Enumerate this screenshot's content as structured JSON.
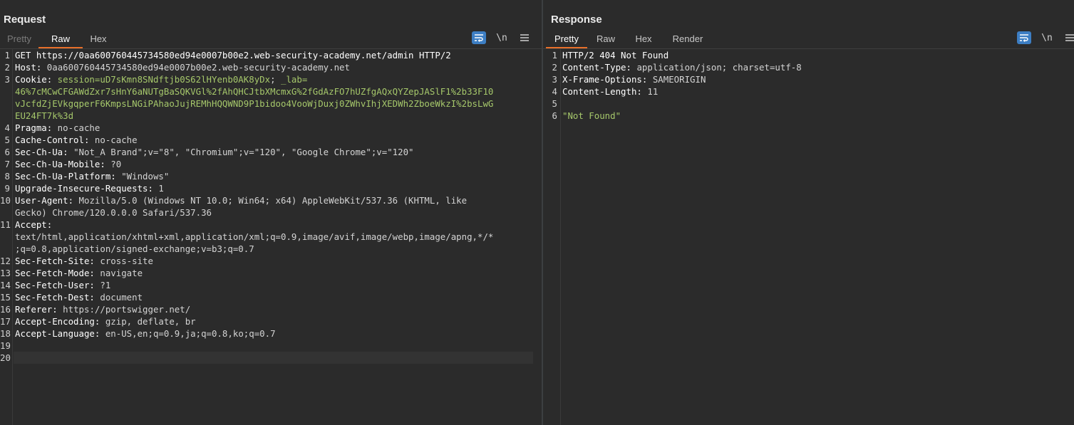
{
  "request": {
    "title": "Request",
    "tabs": [
      {
        "label": "Pretty",
        "state": "disabled"
      },
      {
        "label": "Raw",
        "state": "active"
      },
      {
        "label": "Hex",
        "state": "normal"
      }
    ],
    "toolbar": {
      "newline_label": "\\n"
    },
    "lines": [
      {
        "n": "1",
        "plain": "GET https://0aa600760445734580ed94e0007b00e2.web-security-academy.net/admin HTTP/2"
      },
      {
        "n": "2",
        "name": "Host:",
        "value": " 0aa600760445734580ed94e0007b00e2.web-security-academy.net"
      },
      {
        "n": "3",
        "name": "Cookie:",
        "cookie": " session=uD7sKmn8SNdftjb0S62lHYenb0AK8yDx",
        "value": "; ",
        "cookie2": "_lab="
      },
      {
        "n": "",
        "cookie": "46%7cMCwCFGAWdZxr7sHnY6aNUTgBaSQKVGl%2fAhQHCJtbXMcmxG%2fGdAzFO7hUZfgAQxQYZepJASlF1%2b33F10"
      },
      {
        "n": "",
        "cookie": "vJcfdZjEVkgqperF6KmpsLNGiPAhaoJujREMhHQQWND9P1bidoo4VooWjDuxj0ZWhvIhjXEDWh2ZboeWkzI%2bsLwG"
      },
      {
        "n": "",
        "cookie": "EU24FT7k%3d"
      },
      {
        "n": "4",
        "name": "Pragma:",
        "value": " no-cache"
      },
      {
        "n": "5",
        "name": "Cache-Control:",
        "value": " no-cache"
      },
      {
        "n": "6",
        "name": "Sec-Ch-Ua:",
        "value": " \"Not_A Brand\";v=\"8\", \"Chromium\";v=\"120\", \"Google Chrome\";v=\"120\""
      },
      {
        "n": "7",
        "name": "Sec-Ch-Ua-Mobile:",
        "value": " ?0"
      },
      {
        "n": "8",
        "name": "Sec-Ch-Ua-Platform:",
        "value": " \"Windows\""
      },
      {
        "n": "9",
        "name": "Upgrade-Insecure-Requests:",
        "value": " 1"
      },
      {
        "n": "10",
        "name": "User-Agent:",
        "value": " Mozilla/5.0 (Windows NT 10.0; Win64; x64) AppleWebKit/537.36 (KHTML, like"
      },
      {
        "n": "",
        "value": "Gecko) Chrome/120.0.0.0 Safari/537.36"
      },
      {
        "n": "11",
        "name": "Accept:",
        "value": ""
      },
      {
        "n": "",
        "value": "text/html,application/xhtml+xml,application/xml;q=0.9,image/avif,image/webp,image/apng,*/*"
      },
      {
        "n": "",
        "value": ";q=0.8,application/signed-exchange;v=b3;q=0.7"
      },
      {
        "n": "12",
        "name": "Sec-Fetch-Site:",
        "value": " cross-site"
      },
      {
        "n": "13",
        "name": "Sec-Fetch-Mode:",
        "value": " navigate"
      },
      {
        "n": "14",
        "name": "Sec-Fetch-User:",
        "value": " ?1"
      },
      {
        "n": "15",
        "name": "Sec-Fetch-Dest:",
        "value": " document"
      },
      {
        "n": "16",
        "name": "Referer:",
        "value": " https://portswigger.net/"
      },
      {
        "n": "17",
        "name": "Accept-Encoding:",
        "value": " gzip, deflate, br"
      },
      {
        "n": "18",
        "name": "Accept-Language:",
        "value": " en-US,en;q=0.9,ja;q=0.8,ko;q=0.7"
      },
      {
        "n": "19",
        "value": ""
      },
      {
        "n": "20",
        "value": "",
        "current": true
      }
    ]
  },
  "response": {
    "title": "Response",
    "tabs": [
      {
        "label": "Pretty",
        "state": "active"
      },
      {
        "label": "Raw",
        "state": "normal"
      },
      {
        "label": "Hex",
        "state": "normal"
      },
      {
        "label": "Render",
        "state": "normal"
      }
    ],
    "toolbar": {
      "newline_label": "\\n"
    },
    "lines": [
      {
        "n": "1",
        "plain": "HTTP/2 404 Not Found"
      },
      {
        "n": "2",
        "name": "Content-Type:",
        "value": " application/json; charset=utf-8"
      },
      {
        "n": "3",
        "name": "X-Frame-Options:",
        "value": " SAMEORIGIN"
      },
      {
        "n": "4",
        "name": "Content-Length:",
        "value": " 11"
      },
      {
        "n": "5",
        "value": ""
      },
      {
        "n": "6",
        "json": "\"Not Found\""
      }
    ]
  },
  "colors": {
    "accent_tab": "#e8702a",
    "active_btn": "#3d7ec3",
    "cookie": "#a6c86b"
  },
  "icons": {
    "wrap": "wrap-lines-icon",
    "menu": "hamburger-menu-icon",
    "layout": [
      "split-horizontal-icon",
      "split-vertical-icon",
      "tabs-layout-icon"
    ]
  }
}
